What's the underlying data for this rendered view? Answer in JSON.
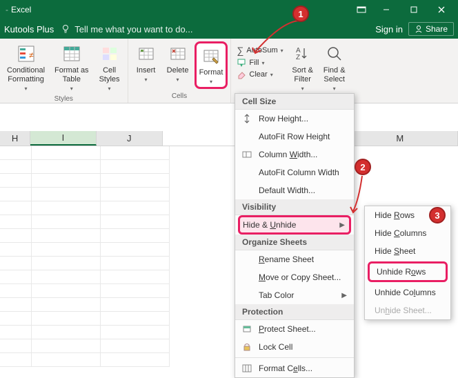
{
  "titlebar": {
    "app_prefix": "- ",
    "app_name": "Excel"
  },
  "menubar": {
    "tab1": "Kutools Plus",
    "tell_me": "Tell me what you want to do...",
    "signin": "Sign in",
    "share": "Share"
  },
  "ribbon": {
    "styles": {
      "conditional": "Conditional\nFormatting",
      "format_as_table": "Format as\nTable",
      "cell_styles": "Cell\nStyles",
      "group_label": "Styles"
    },
    "cells": {
      "insert": "Insert",
      "delete": "Delete",
      "format": "Format",
      "group_label": "Cells"
    },
    "editing": {
      "autosum": "AutoSum",
      "fill": "Fill",
      "clear": "Clear",
      "sort_filter": "Sort &\nFilter",
      "find_select": "Find &\nSelect"
    }
  },
  "columns": [
    "H",
    "I",
    "J",
    "M"
  ],
  "format_menu": {
    "cell_size": "Cell Size",
    "row_height": "Row Height...",
    "autofit_row": "AutoFit Row Height",
    "col_width": "Column Width...",
    "autofit_col": "AutoFit Column Width",
    "default_width": "Default Width...",
    "visibility": "Visibility",
    "hide_unhide": "Hide & Unhide",
    "organize": "Organize Sheets",
    "rename": "Rename Sheet",
    "move_copy": "Move or Copy Sheet...",
    "tab_color": "Tab Color",
    "protection": "Protection",
    "protect_sheet": "Protect Sheet...",
    "lock_cell": "Lock Cell",
    "format_cells": "Format Cells..."
  },
  "hide_submenu": {
    "hide_rows": "Hide Rows",
    "hide_columns": "Hide Columns",
    "hide_sheet": "Hide Sheet",
    "unhide_rows": "Unhide Rows",
    "unhide_columns": "Unhide Columns",
    "unhide_sheet": "Unhide Sheet..."
  },
  "callouts": {
    "c1": "1",
    "c2": "2",
    "c3": "3"
  }
}
